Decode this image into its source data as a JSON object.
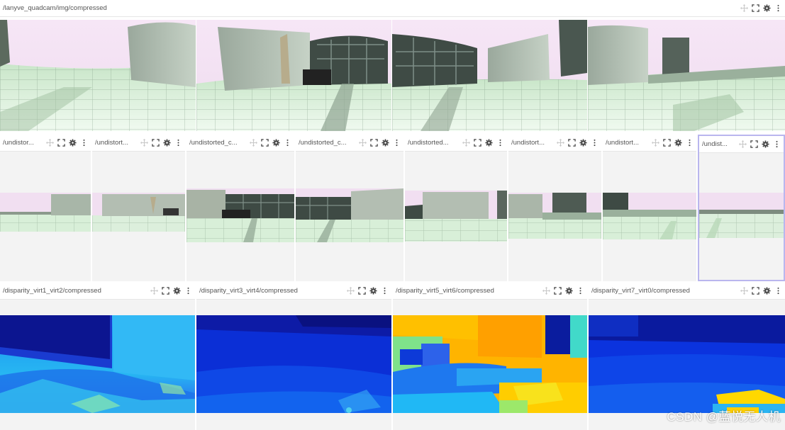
{
  "top_panel": {
    "topic": "/lanyve_quadcam/img/compressed"
  },
  "undistorted_panels": [
    {
      "topic": "/undistor..."
    },
    {
      "topic": "/undistort..."
    },
    {
      "topic": "/undistorted_c..."
    },
    {
      "topic": "/undistorted_c..."
    },
    {
      "topic": "/undistorted..."
    },
    {
      "topic": "/undistort..."
    },
    {
      "topic": "/undistort..."
    },
    {
      "topic": "/undist..."
    }
  ],
  "disparity_panels": [
    {
      "topic": "/disparity_virt1_virt2/compressed"
    },
    {
      "topic": "/disparity_virt3_virt4/compressed"
    },
    {
      "topic": "/disparity_virt5_virt6/compressed"
    },
    {
      "topic": "/disparity_virt7_virt0/compressed"
    }
  ],
  "watermark": "CSDN @蓝悦无人机",
  "icons": {
    "move": "move-icon",
    "fullscreen": "fullscreen-icon",
    "settings": "gear-icon",
    "menu": "more-vertical-icon"
  },
  "colors": {
    "selected_outline": "#b9b6ee",
    "panel_bg": "#f3f3f3",
    "sky": "#f2dff2",
    "disparity_far": "#0a0f8a",
    "disparity_mid": "#1a7df0",
    "disparity_near": "#ffcc00"
  }
}
